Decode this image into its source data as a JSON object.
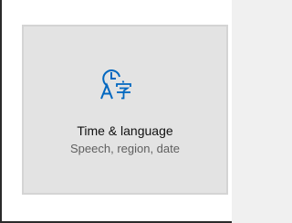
{
  "tile": {
    "title": "Time & language",
    "subtitle": "Speech, region, date",
    "icon": "time-language-icon",
    "accent_color": "#0067c0"
  }
}
